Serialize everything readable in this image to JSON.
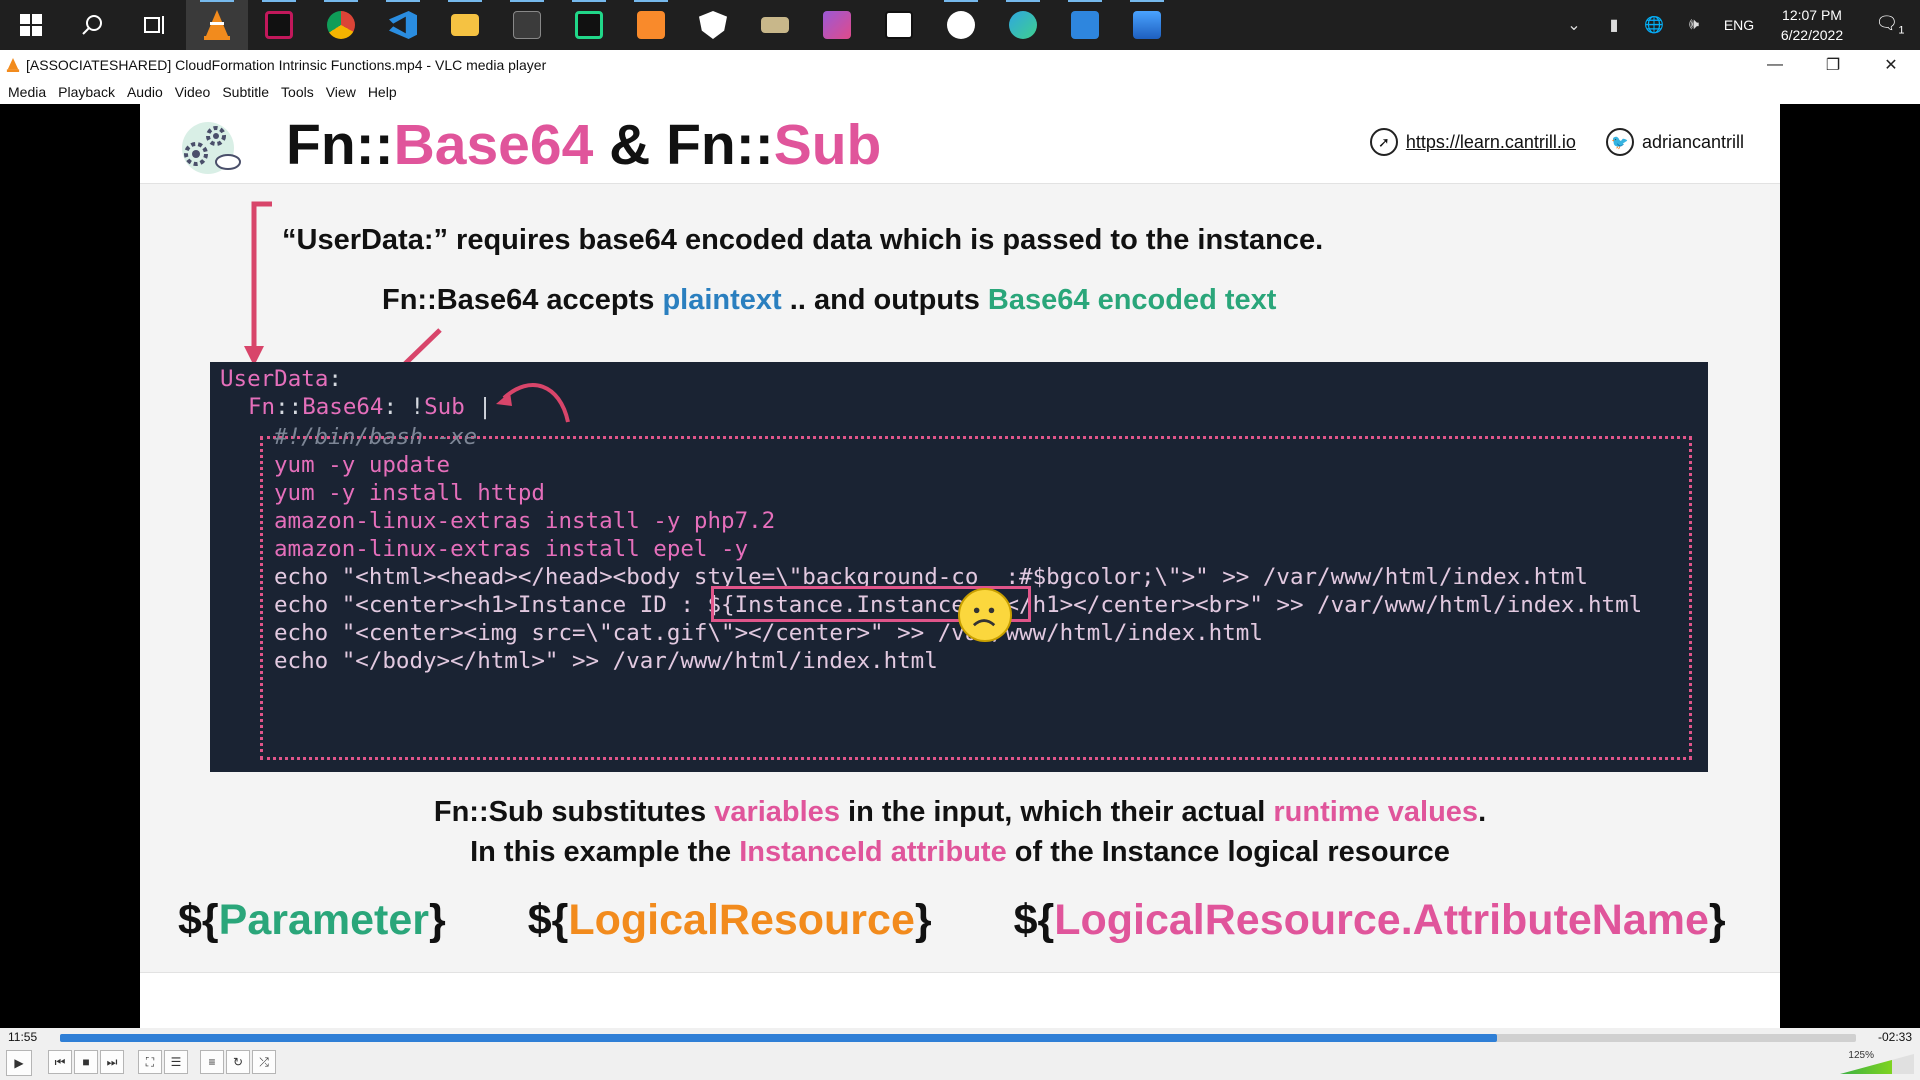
{
  "taskbar": {
    "apps": [
      {
        "name": "start-icon",
        "color": "#ffffff"
      },
      {
        "name": "search-icon",
        "color": "#ffffff"
      },
      {
        "name": "task-view-icon",
        "color": "#ffffff"
      },
      {
        "name": "vlc-icon",
        "color": "#f28b1d"
      },
      {
        "name": "intellij-icon",
        "color": "#c2185b"
      },
      {
        "name": "chrome-icon",
        "color": "#4caf50"
      },
      {
        "name": "vscode-icon",
        "color": "#2a8de0"
      },
      {
        "name": "file-explorer-icon",
        "color": "#f5c242"
      },
      {
        "name": "terminal-icon",
        "color": "#444444"
      },
      {
        "name": "pycharm-icon",
        "color": "#21d789"
      },
      {
        "name": "sublime-icon",
        "color": "#f98a2b"
      },
      {
        "name": "defender-icon",
        "color": "#ffffff"
      },
      {
        "name": "books-icon",
        "color": "#c8b78a"
      },
      {
        "name": "visual-studio-icon",
        "color": "#9b59d6"
      },
      {
        "name": "notion-icon",
        "color": "#ffffff"
      },
      {
        "name": "clock-app-icon",
        "color": "#ffffff"
      },
      {
        "name": "edge-icon",
        "color": "#2fa7e0"
      },
      {
        "name": "media-player-icon",
        "color": "#2e86de"
      },
      {
        "name": "photos-icon",
        "color": "#1e90ff"
      }
    ],
    "tray": {
      "language": "ENG",
      "time": "12:07 PM",
      "date": "6/22/2022",
      "notification_count": "1"
    }
  },
  "window": {
    "title": "[ASSOCIATESHARED] CloudFormation Intrinsic Functions.mp4 - VLC media player"
  },
  "menu": [
    "Media",
    "Playback",
    "Audio",
    "Video",
    "Subtitle",
    "Tools",
    "View",
    "Help"
  ],
  "slide": {
    "title_prefix": "Fn::",
    "title_base64": "Base64",
    "title_amp": " & Fn::",
    "title_sub": "Sub",
    "link_url": "https://learn.cantrill.io",
    "handle": "adriancantrill",
    "line1": "“UserData:” requires base64 encoded data which is passed to the instance.",
    "line2_a": "Fn::Base64 accepts ",
    "line2_b": "plaintext",
    "line2_c": " .. and outputs ",
    "line2_d": "Base64 encoded text",
    "code": {
      "l1_key": "UserData",
      "l1_colon": ":",
      "l2_fn": "Fn",
      "l2_sep": "::",
      "l2_base": "Base64",
      "l2_rest": ": !",
      "l2_sub": "Sub",
      "l2_pipe": " |",
      "l3": "#!/bin/bash -xe",
      "l4": "yum -y update",
      "l5": "yum -y install httpd",
      "l6": "amazon-linux-extras install -y php7.2",
      "l7": "amazon-linux-extras install epel -y",
      "l8": "echo \"<html><head></head><body style=\\\"background-co  :#$bgcolor;\\\">\" >> /var/www/html/index.html",
      "l9": "echo \"<center><h1>Instance ID : ${Instance.InstanceId}</h1></center><br>\" >> /var/www/html/index.html",
      "l10": "echo \"<center><img src=\\\"cat.gif\\\"></center>\" >> /var/www/html/index.html",
      "l11": "echo \"</body></html>\" >> /var/www/html/index.html"
    },
    "bottom1_a": "Fn::Sub substitutes ",
    "bottom1_b": "variables",
    "bottom1_c": " in the input, which their actual ",
    "bottom1_d": "runtime values",
    "bottom1_e": ".",
    "bottom2_a": "In this example the ",
    "bottom2_b": "InstanceId attribute",
    "bottom2_c": " of the Instance logical resource",
    "var1_open": "${",
    "var1_name": "Parameter",
    "var1_close": "}",
    "var2_open": "${",
    "var2_name": "LogicalResource",
    "var2_close": "}",
    "var3_open": "${",
    "var3_name": "LogicalResource.AttributeName",
    "var3_close": "}"
  },
  "player": {
    "elapsed": "11:55",
    "remaining": "-02:33",
    "progress": 0.8,
    "volume_label": "125%",
    "volume": 1.25
  },
  "colors": {
    "accent_pink": "#e0559b",
    "accent_blue": "#2a7fbf",
    "accent_green": "#2aa67a",
    "accent_orange": "#f28b1d",
    "code_bg": "#1a2333",
    "seek_fill": "#2f7fd6"
  }
}
